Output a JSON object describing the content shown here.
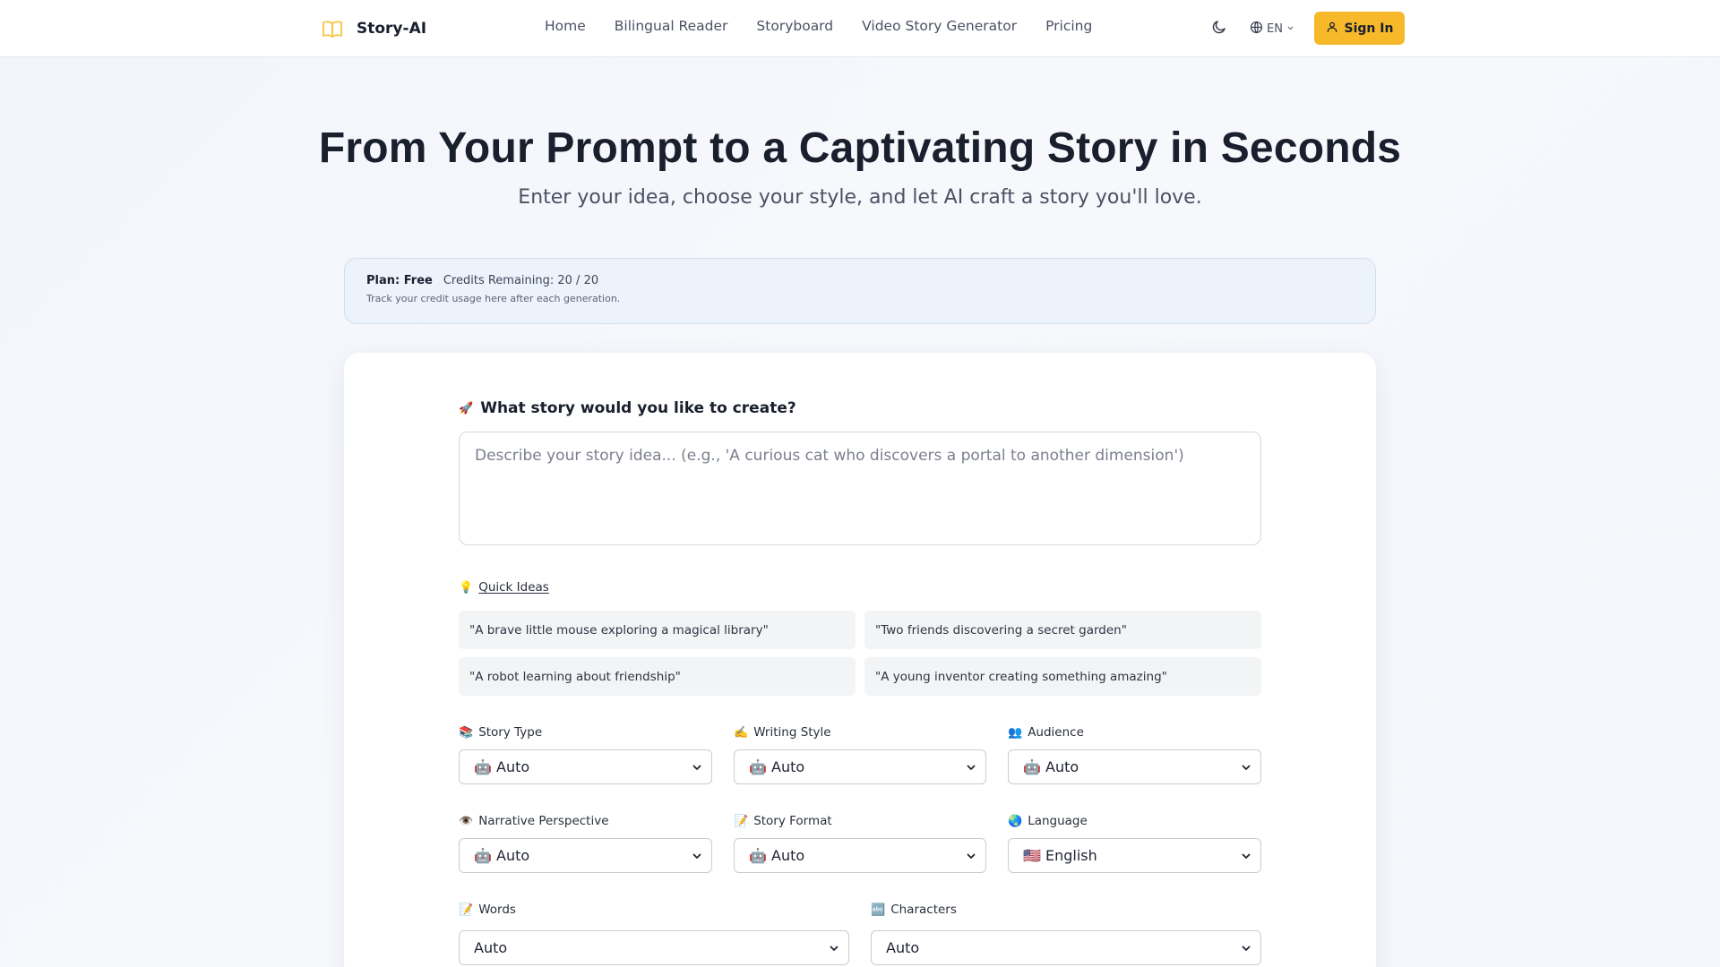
{
  "header": {
    "brand": "Story-AI",
    "logo_icon": "open-book-icon",
    "nav": [
      {
        "label": "Home"
      },
      {
        "label": "Bilingual Reader"
      },
      {
        "label": "Storyboard"
      },
      {
        "label": "Video Story Generator"
      },
      {
        "label": "Pricing"
      }
    ],
    "theme_icon": "moon-icon",
    "language": {
      "icon": "globe-icon",
      "label": "EN"
    },
    "signin_label": "Sign In",
    "accent_color": "#f7b82a"
  },
  "hero": {
    "title": "From Your Prompt to a Captivating Story in Seconds",
    "subtitle": "Enter your idea, choose your style, and let AI craft a story you'll love."
  },
  "plan": {
    "label": "Plan: Free",
    "credits": "Credits Remaining: 20 / 20",
    "note": "Track your credit usage here after each generation."
  },
  "form": {
    "prompt": {
      "emoji": "🚀",
      "label": "What story would you like to create?",
      "placeholder": "Describe your story idea... (e.g., 'A curious cat who discovers a portal to another dimension')"
    },
    "quick_ideas": {
      "emoji": "💡",
      "label": "Quick Ideas",
      "items": [
        "\"A brave little mouse exploring a magical library\"",
        "\"Two friends discovering a secret garden\"",
        "\"A robot learning about friendship\"",
        "\"A young inventor creating something amazing\""
      ]
    },
    "selects": {
      "story_type": {
        "emoji": "📚",
        "label": "Story Type",
        "value": "🤖 Auto"
      },
      "writing_style": {
        "emoji": "✍️",
        "label": "Writing Style",
        "value": "🤖 Auto"
      },
      "audience": {
        "emoji": "👥",
        "label": "Audience",
        "value": "🤖 Auto"
      },
      "narrative": {
        "emoji": "👁️",
        "label": "Narrative Perspective",
        "value": "🤖 Auto"
      },
      "format": {
        "emoji": "📝",
        "label": "Story Format",
        "value": "🤖 Auto"
      },
      "language": {
        "emoji": "🌏",
        "label": "Language",
        "value": "🇺🇸 English"
      },
      "words": {
        "emoji": "📝",
        "label": "Words",
        "value": "Auto"
      },
      "characters": {
        "emoji": "🔤",
        "label": "Characters",
        "value": "Auto"
      }
    }
  }
}
